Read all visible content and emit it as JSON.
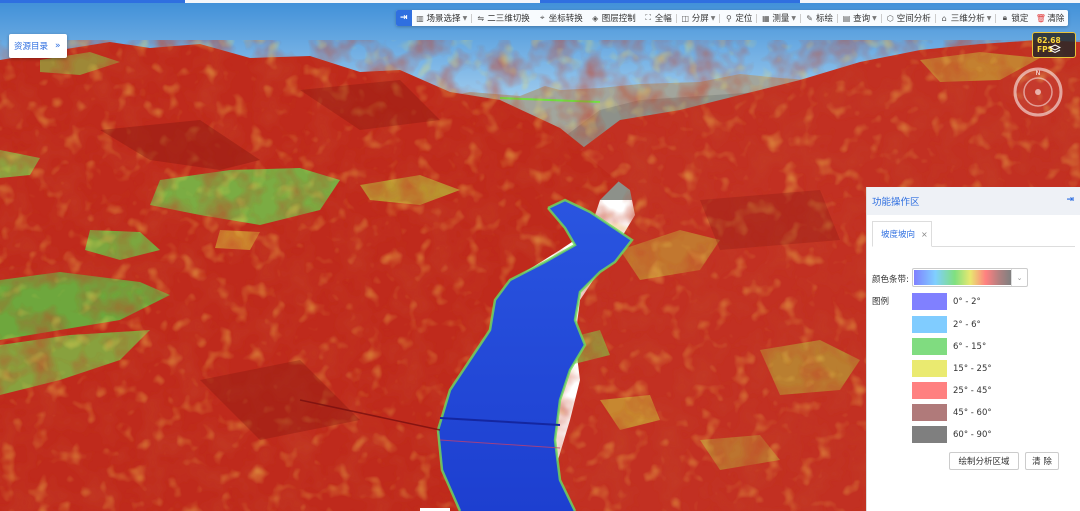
{
  "toolbar": {
    "pin_icon": "pin-right-icon",
    "items": [
      {
        "label": "场景选择",
        "icon": "scene-icon",
        "dropdown": true
      },
      {
        "label": "二三维切换",
        "icon": "switch-2d3d-icon",
        "dropdown": false
      },
      {
        "label": "坐标转换",
        "icon": "coordinate-icon",
        "dropdown": false
      },
      {
        "label": "图层控制",
        "icon": "layers-icon",
        "dropdown": false
      },
      {
        "label": "全幅",
        "icon": "fullscreen-icon",
        "dropdown": false
      },
      {
        "label": "分屏",
        "icon": "split-screen-icon",
        "dropdown": true
      },
      {
        "label": "定位",
        "icon": "locate-icon",
        "dropdown": false
      },
      {
        "label": "测量",
        "icon": "measure-icon",
        "dropdown": true
      },
      {
        "label": "标绘",
        "icon": "plot-icon",
        "dropdown": false
      },
      {
        "label": "查询",
        "icon": "query-icon",
        "dropdown": true
      },
      {
        "label": "空间分析",
        "icon": "spatial-analysis-icon",
        "dropdown": false
      },
      {
        "label": "三维分析",
        "icon": "3d-analysis-icon",
        "dropdown": true
      },
      {
        "label": "锁定",
        "icon": "lock-icon",
        "dropdown": false
      },
      {
        "label": "清除",
        "icon": "trash-icon",
        "dropdown": false
      }
    ]
  },
  "resource_directory": {
    "label": "资源目录",
    "icon": "double-chevron-right-icon"
  },
  "fps": {
    "text": "62.68 FPS"
  },
  "compass": {
    "north_label": "N"
  },
  "panel": {
    "title": "功能操作区",
    "collapse_icon": "collapse-right-icon",
    "tab_label": "坡度坡向",
    "tab_close": "×",
    "color_ramp_label": "颜色条带:",
    "legend_label": "图例",
    "legend": [
      {
        "range": "0° - 2°",
        "color": "#8080ff"
      },
      {
        "range": "2° - 6°",
        "color": "#80ccff"
      },
      {
        "range": "6° - 15°",
        "color": "#80dc80"
      },
      {
        "range": "15° - 25°",
        "color": "#eaea70"
      },
      {
        "range": "25° - 45°",
        "color": "#ff8080"
      },
      {
        "range": "45° - 60°",
        "color": "#b07a7a"
      },
      {
        "range": "60° - 90°",
        "color": "#7f7f7f"
      }
    ],
    "draw_button": "绘制分析区域",
    "clear_button": "清 除"
  },
  "colors": {
    "accent": "#2f6fe0",
    "slope_red": "#c0261c",
    "river_blue": "#1f47d6",
    "sky": "#b9d8ef"
  }
}
